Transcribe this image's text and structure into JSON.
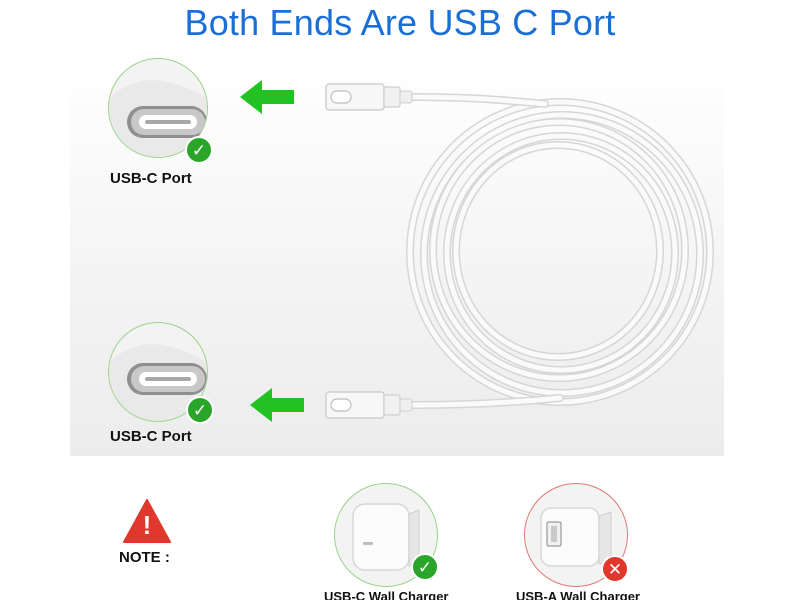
{
  "title": "Both Ends Are USB C Port",
  "ports": [
    {
      "label": "USB-C Port",
      "status": "ok"
    },
    {
      "label": "USB-C Port",
      "status": "ok"
    }
  ],
  "note": {
    "label": "NOTE :"
  },
  "chargers": [
    {
      "label": "USB-C Wall Charger",
      "status": "ok"
    },
    {
      "label": "USB-A Wall Charger",
      "status": "no"
    }
  ],
  "icons": {
    "check": "✓",
    "cross": "✕",
    "warning": "!"
  },
  "colors": {
    "title": "#1a6fd6",
    "arrow": "#22c222",
    "ok": "#2aa52a",
    "no": "#e0382c",
    "warning": "#e0382c"
  }
}
